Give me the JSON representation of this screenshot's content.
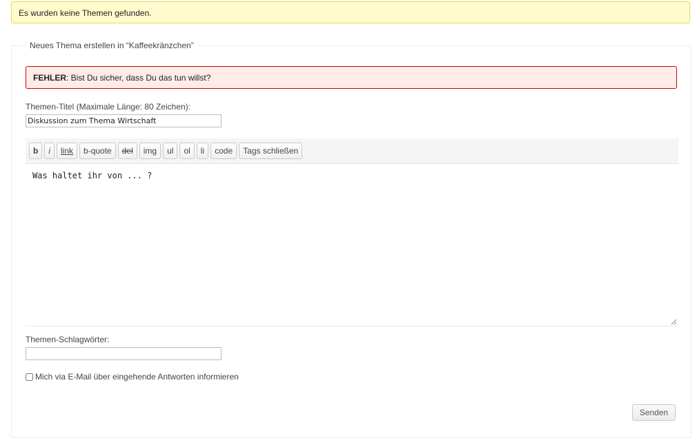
{
  "notice": {
    "text": "Es wurden keine Themen gefunden."
  },
  "form": {
    "legend": "Neues Thema erstellen in “Kaffeekränzchen”",
    "error": {
      "label": "FEHLER",
      "message": ": Bist Du sicher, dass Du das tun willst?"
    },
    "title_label": "Themen-Titel (Maximale Länge: 80 Zeichen):",
    "title_value": "Diskussion zum Thema Wirtschaft",
    "toolbar": [
      {
        "label": "b",
        "name": "bold-button",
        "style": "b"
      },
      {
        "label": "i",
        "name": "italic-button",
        "style": "i"
      },
      {
        "label": "link",
        "name": "link-button",
        "style": "link"
      },
      {
        "label": "b-quote",
        "name": "blockquote-button",
        "style": ""
      },
      {
        "label": "del",
        "name": "del-button",
        "style": "del"
      },
      {
        "label": "img",
        "name": "img-button",
        "style": ""
      },
      {
        "label": "ul",
        "name": "ul-button",
        "style": ""
      },
      {
        "label": "ol",
        "name": "ol-button",
        "style": ""
      },
      {
        "label": "li",
        "name": "li-button",
        "style": ""
      },
      {
        "label": "code",
        "name": "code-button",
        "style": ""
      },
      {
        "label": "Tags schließen",
        "name": "close-tags-button",
        "style": ""
      }
    ],
    "content_value": "Was haltet ihr von ... ?",
    "tags_label": "Themen-Schlagwörter:",
    "tags_value": "",
    "subscribe_label": "Mich via E-Mail über eingehende Antworten informieren",
    "subscribe_checked": false,
    "submit_label": "Senden"
  }
}
